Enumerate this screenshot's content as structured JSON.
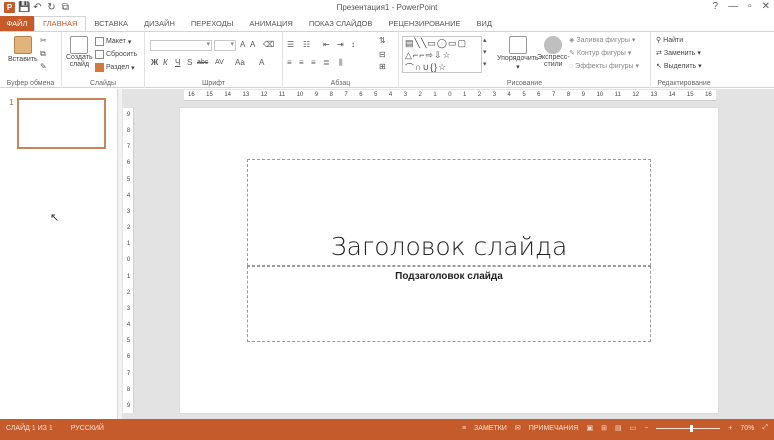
{
  "window": {
    "title": "Презентация1 - PowerPoint",
    "help": "?",
    "minimize": "—",
    "maximize": "▫",
    "close": "✕"
  },
  "qat": {
    "app_icon": "P",
    "save": "💾",
    "undo": "↶",
    "redo": "↻",
    "start": "⧉"
  },
  "tabs": [
    "ФАЙЛ",
    "ГЛАВНАЯ",
    "ВСТАВКА",
    "ДИЗАЙН",
    "ПЕРЕХОДЫ",
    "АНИМАЦИЯ",
    "ПОКАЗ СЛАЙДОВ",
    "РЕЦЕНЗИРОВАНИЕ",
    "ВИД"
  ],
  "ribbon": {
    "clipboard": {
      "label": "Буфер обмена",
      "paste": "Вставить"
    },
    "slides": {
      "label": "Слайды",
      "new_slide_1": "Создать",
      "new_slide_2": "слайд",
      "layout": "Макет",
      "reset": "Сбросить",
      "section": "Раздел"
    },
    "font": {
      "label": "Шрифт",
      "bold": "Ж",
      "italic": "К",
      "underline": "Ч",
      "strike": "S",
      "shadow": "abc",
      "spacing": "AV",
      "case": "Aa",
      "color": "A"
    },
    "paragraph": {
      "label": "Абзац"
    },
    "drawing": {
      "label": "Рисование",
      "arrange": "Упорядочить",
      "quick_styles_1": "Экспресс-",
      "quick_styles_2": "стили",
      "fill": "Заливка фигуры",
      "outline": "Контур фигуры",
      "effects": "Эффекты фигуры"
    },
    "editing": {
      "label": "Редактирование",
      "find": "Найти",
      "replace": "Заменить",
      "select": "Выделить"
    }
  },
  "thumbnail": {
    "number": "1"
  },
  "slide": {
    "title": "Заголовок слайда",
    "subtitle": "Подзаголовок слайда"
  },
  "statusbar": {
    "slide_info": "СЛАЙД 1 ИЗ 1",
    "language": "РУССКИЙ",
    "notes": "ЗАМЕТКИ",
    "comments": "ПРИМЕЧАНИЯ",
    "zoom": "70%",
    "zoom_level": 0.55
  },
  "hruler": [
    "16",
    "15",
    "14",
    "13",
    "12",
    "11",
    "10",
    "9",
    "8",
    "7",
    "6",
    "5",
    "4",
    "3",
    "2",
    "1",
    "0",
    "1",
    "2",
    "3",
    "4",
    "5",
    "6",
    "7",
    "8",
    "9",
    "10",
    "11",
    "12",
    "13",
    "14",
    "15",
    "16"
  ],
  "vruler": [
    "9",
    "8",
    "7",
    "6",
    "5",
    "4",
    "3",
    "2",
    "1",
    "0",
    "1",
    "2",
    "3",
    "4",
    "5",
    "6",
    "7",
    "8",
    "9"
  ],
  "colors": {
    "accent": "#c55a2a"
  }
}
